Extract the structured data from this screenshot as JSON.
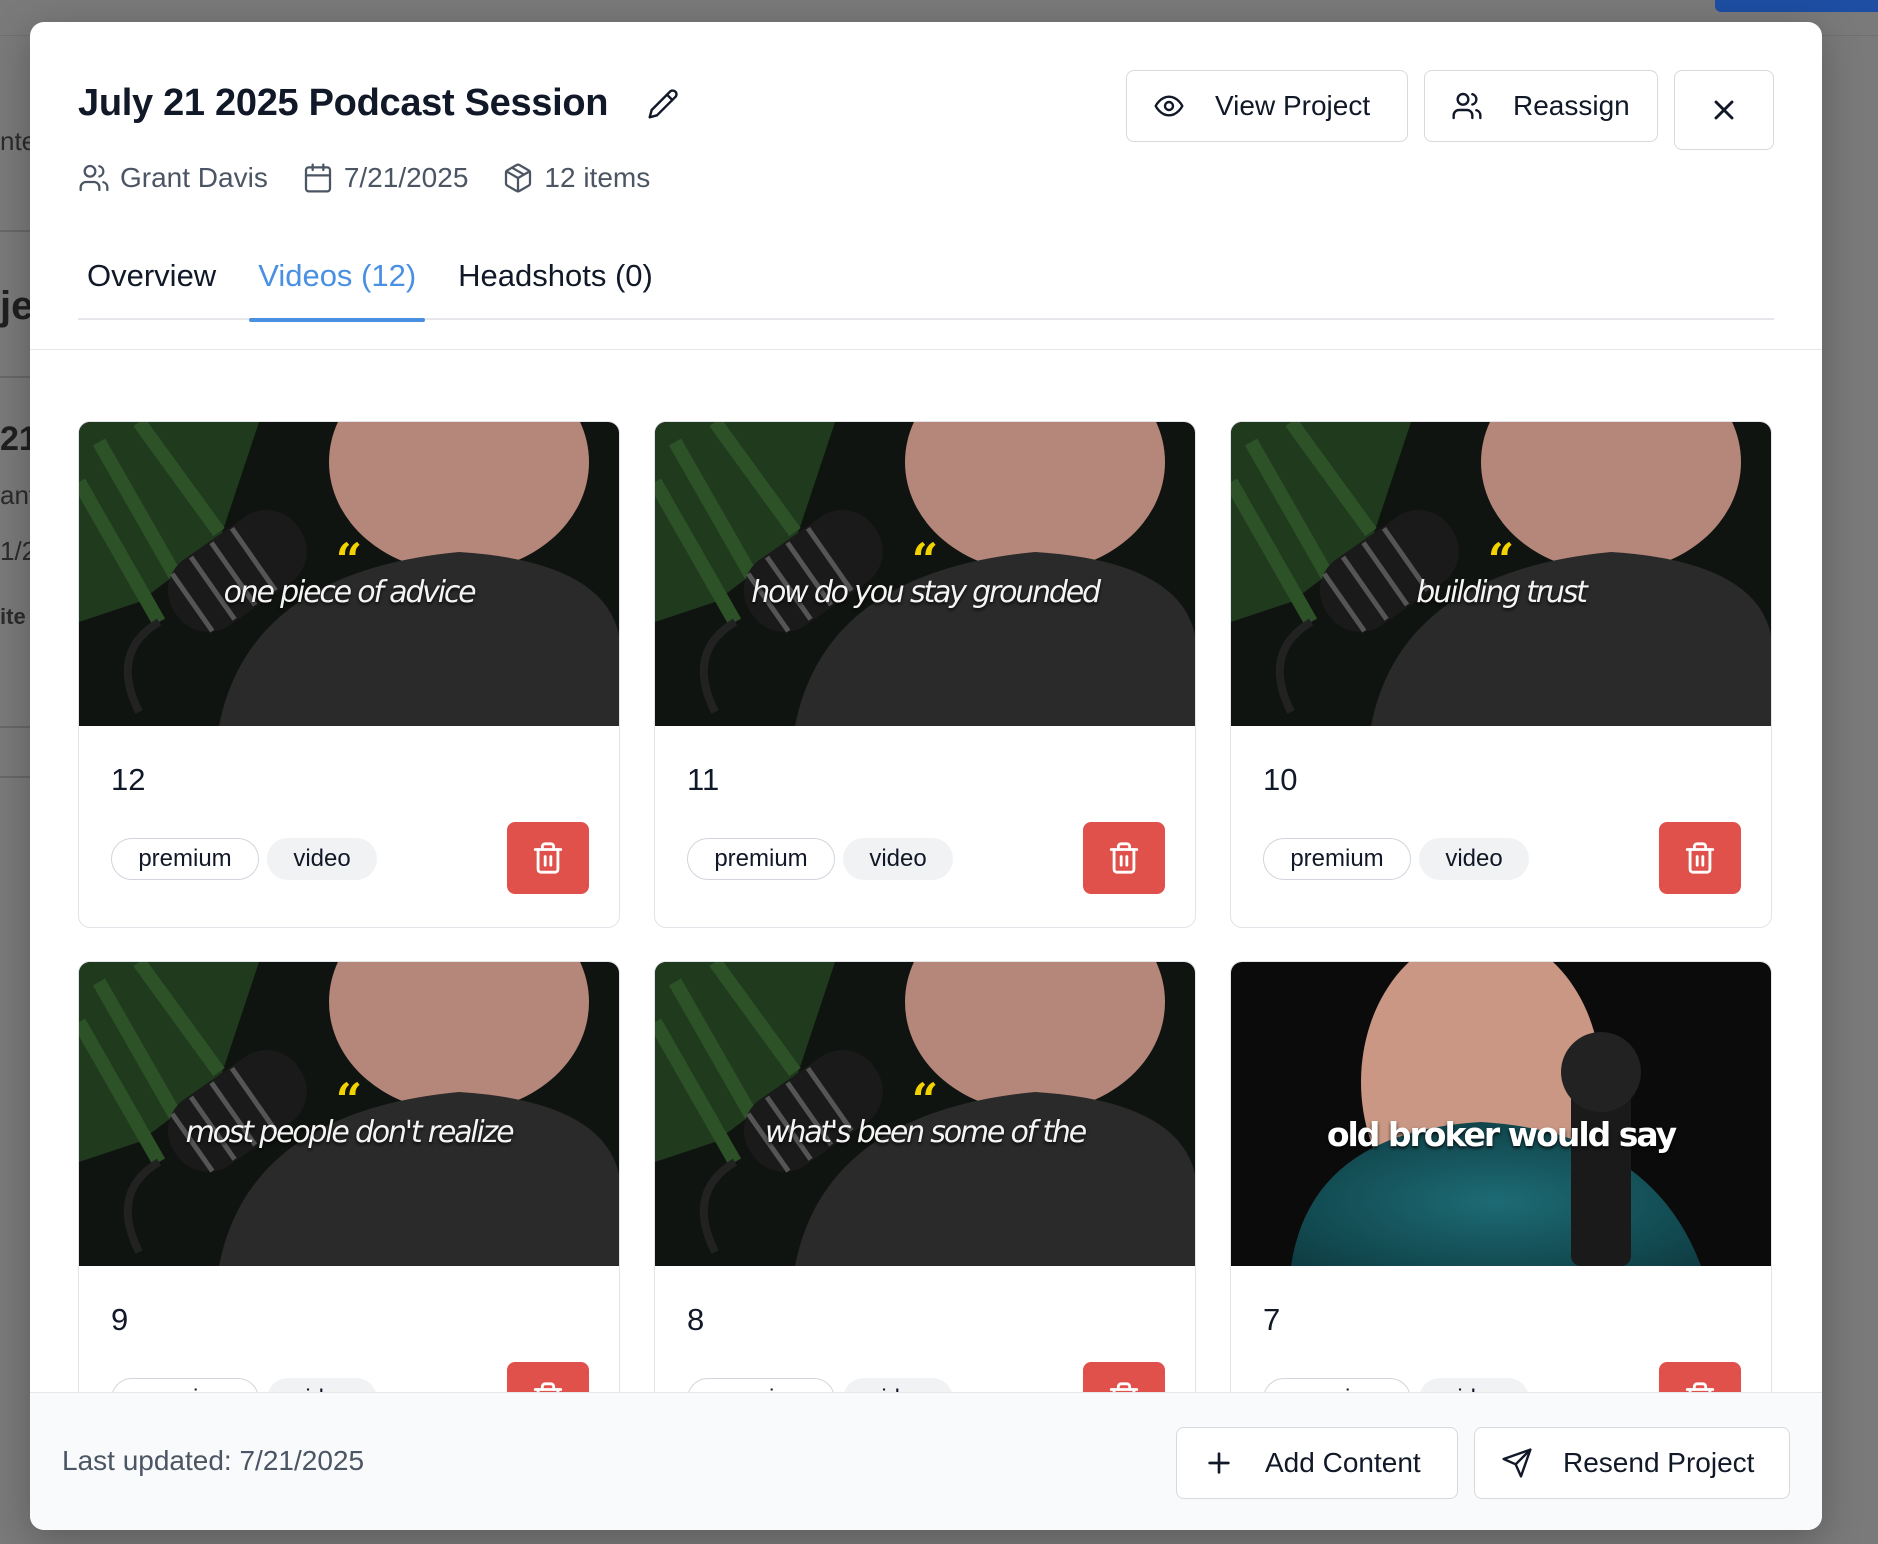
{
  "background": {
    "fragments": [
      "nte",
      "je",
      "21",
      "ant",
      "1/2",
      "ite"
    ]
  },
  "modal": {
    "title": "July 21 2025 Podcast Session",
    "meta": {
      "owner": "Grant Davis",
      "date": "7/21/2025",
      "items": "12 items"
    },
    "buttons": {
      "view_project": "View Project",
      "reassign": "Reassign"
    },
    "tabs": [
      {
        "label": "Overview",
        "active": false
      },
      {
        "label": "Videos (12)",
        "active": true
      },
      {
        "label": "Headshots (0)",
        "active": false
      }
    ],
    "accent_color": "#4a90e2",
    "delete_color": "#e0514c",
    "videos": [
      {
        "number": "12",
        "caption": "one piece of advice",
        "style": "quote",
        "tags": [
          "premium",
          "video"
        ]
      },
      {
        "number": "11",
        "caption": "how do you stay grounded",
        "style": "quote",
        "tags": [
          "premium",
          "video"
        ]
      },
      {
        "number": "10",
        "caption": "building trust",
        "style": "quote",
        "tags": [
          "premium",
          "video"
        ]
      },
      {
        "number": "9",
        "caption": "most people don't realize",
        "style": "quote",
        "tags": [
          "premium",
          "video"
        ]
      },
      {
        "number": "8",
        "caption": "what's been some of the",
        "style": "quote",
        "tags": [
          "premium",
          "video"
        ]
      },
      {
        "number": "7",
        "caption": "old broker would say",
        "style": "plain",
        "tags": [
          "premium",
          "video"
        ]
      }
    ],
    "footer": {
      "last_updated": "Last updated: 7/21/2025",
      "add_content": "Add Content",
      "resend_project": "Resend Project"
    }
  }
}
